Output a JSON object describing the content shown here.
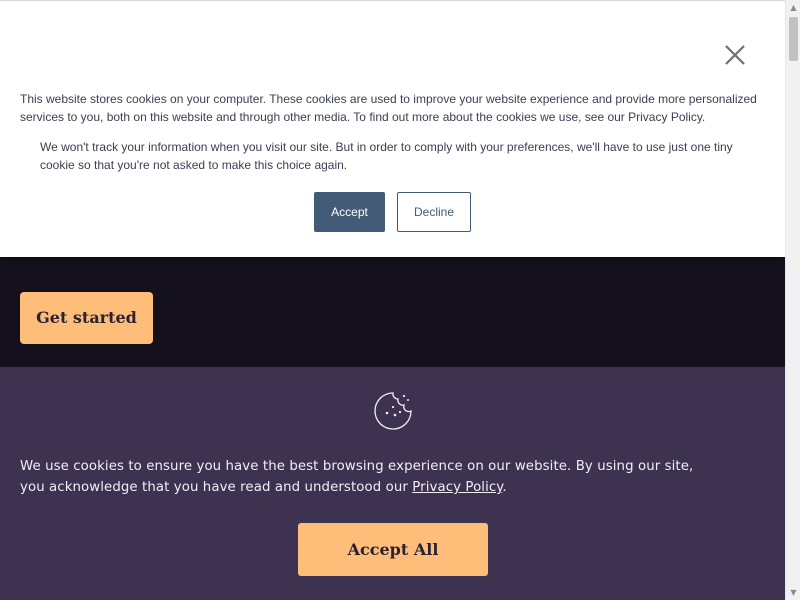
{
  "hero": {
    "cta_label": "Get started"
  },
  "footer_banner": {
    "text_before_link": "We use cookies to ensure you have the best browsing experience on our website. By using our site, you acknowledge that you have read and understood our ",
    "link_label": "Privacy Policy",
    "text_after_link": ".",
    "accept_all_label": "Accept All",
    "icon": "cookie-icon"
  },
  "modal": {
    "paragraph_1": "This website stores cookies on your computer. These cookies are used to improve your website experience and provide more personalized services to you, both on this website and through other media. To find out more about the cookies we use, see our Privacy Policy.",
    "paragraph_2": "We won't track your information when you visit our site. But in order to comply with your preferences, we'll have to use just one tiny cookie so that you're not asked to make this choice again.",
    "accept_label": "Accept",
    "decline_label": "Decline",
    "close_icon": "close-icon"
  },
  "colors": {
    "hero_background": "#14111c",
    "banner_background": "#3d3350",
    "cta_orange": "#ffbd7a",
    "modal_button_blue": "#425b76"
  }
}
